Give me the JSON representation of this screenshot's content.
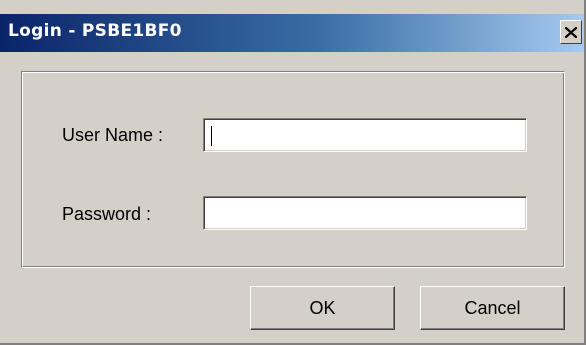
{
  "window": {
    "title": "Login - PSBE1BF0",
    "close_icon": "close-icon"
  },
  "form": {
    "user_name_label": "User Name :",
    "user_name_value": "",
    "password_label": "Password :",
    "password_value": ""
  },
  "buttons": {
    "ok_label": "OK",
    "cancel_label": "Cancel"
  },
  "colors": {
    "dialog_face": "#d4d0c8",
    "title_start": "#0a246a",
    "title_end": "#a6caf0"
  }
}
